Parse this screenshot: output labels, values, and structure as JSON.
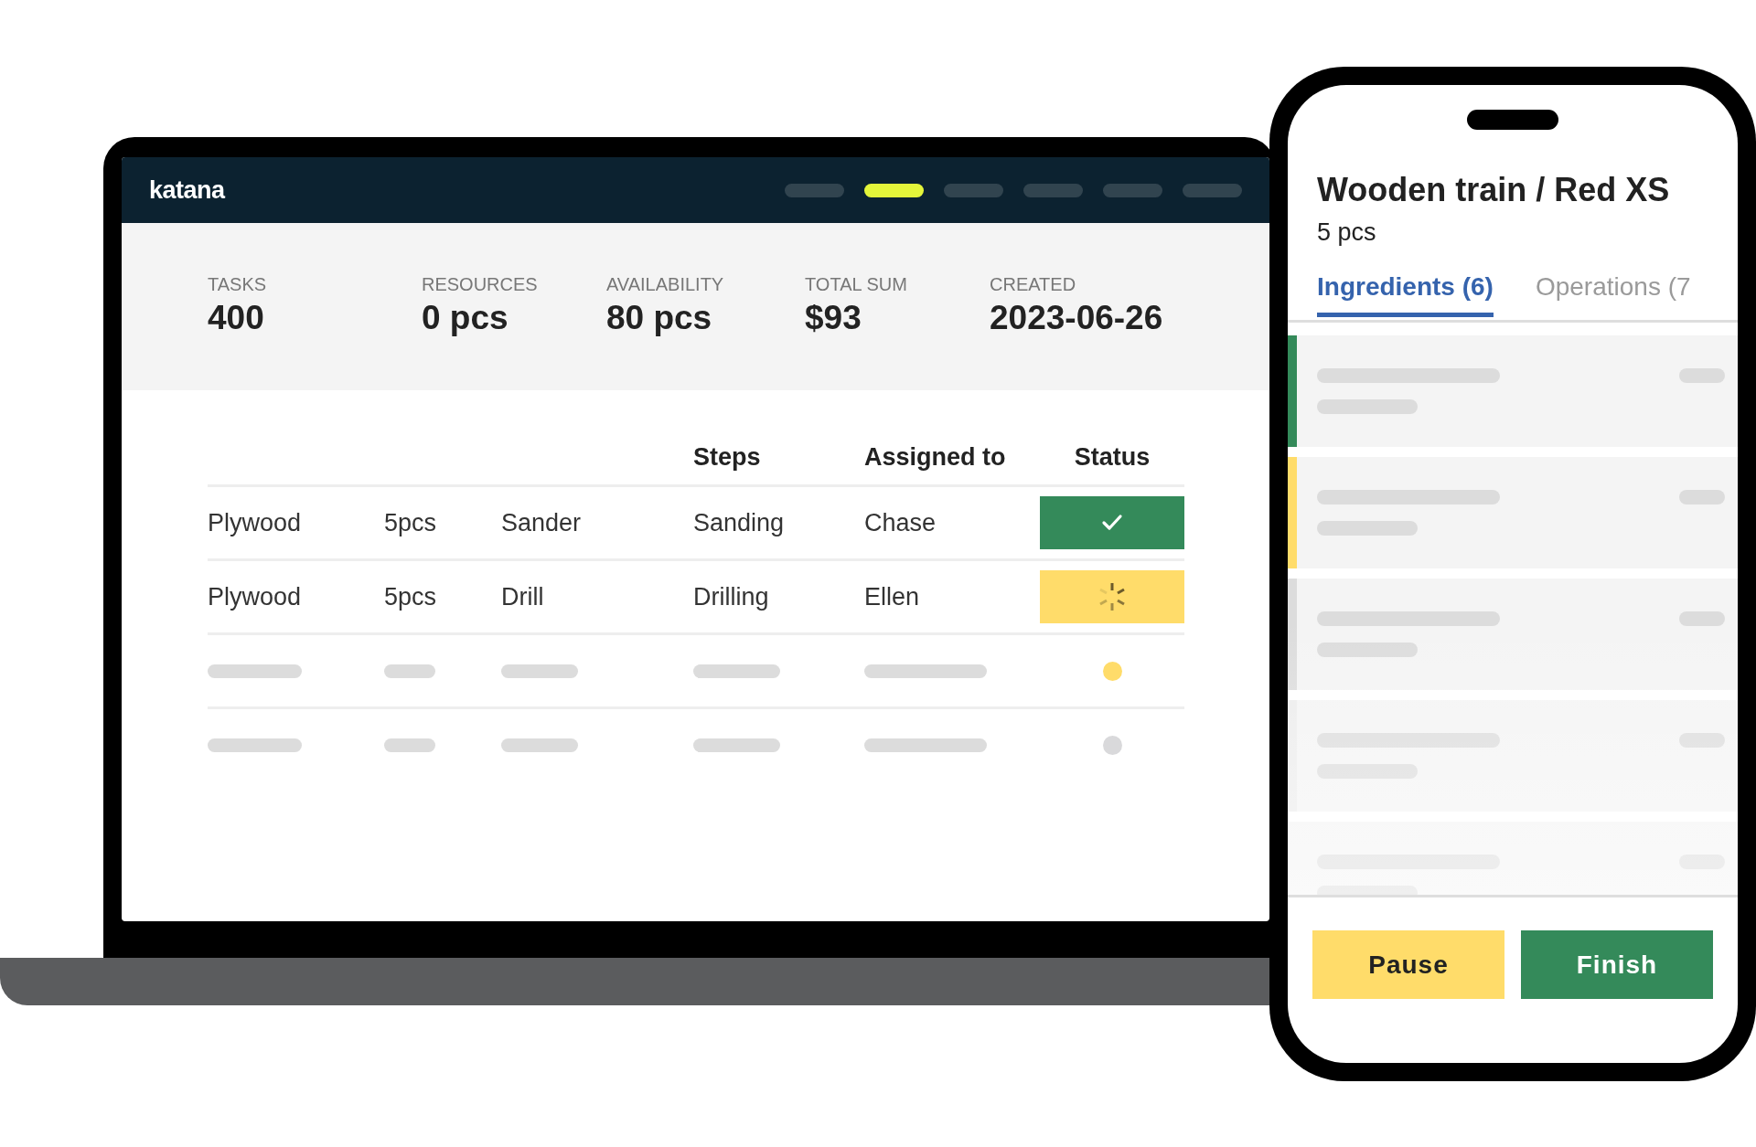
{
  "laptop": {
    "logo": "katana",
    "nav": [
      {
        "selected": false
      },
      {
        "selected": true
      },
      {
        "selected": false
      },
      {
        "selected": false
      },
      {
        "selected": false
      },
      {
        "selected": false
      }
    ],
    "stats": [
      {
        "label": "TASKS",
        "value": "400"
      },
      {
        "label": "RESOURCES",
        "value": "0 pcs"
      },
      {
        "label": "AVAILABILITY",
        "value": "80 pcs"
      },
      {
        "label": "TOTAL SUM",
        "value": "$93"
      },
      {
        "label": "CREATED",
        "value": "2023-06-26"
      }
    ],
    "table": {
      "headers": {
        "steps": "Steps",
        "assigned_to": "Assigned to",
        "status": "Status"
      },
      "rows": [
        {
          "kind": "done",
          "column_1": "Plywood",
          "column_2": "5pcs",
          "column_3": "Sander",
          "steps": "Sanding",
          "assigned_to": "Chase"
        },
        {
          "kind": "in_progress",
          "column_1": "Plywood",
          "column_2": "5pcs",
          "column_3": "Drill",
          "steps": "Drilling",
          "assigned_to": "Ellen"
        },
        {
          "kind": "placeholder",
          "color": "#ffdc6a"
        },
        {
          "kind": "placeholder",
          "color": "#d9d9db"
        }
      ]
    }
  },
  "phone": {
    "title": "Wooden train / Red XS",
    "quantity": "5 pcs",
    "tabs": [
      {
        "label": "Ingredients (6)",
        "selected": true
      },
      {
        "label": "Operations (7",
        "selected": false
      }
    ],
    "cards": [
      {
        "kind": "striped",
        "color": "#348a5a"
      },
      {
        "kind": "striped",
        "color": "#ffdc6a"
      },
      {
        "kind": "striped",
        "color": "#dcdcdc"
      },
      {
        "kind": "striped",
        "color": "#ececec"
      },
      {
        "kind": "plain"
      }
    ],
    "buttons": [
      {
        "label": "Pause",
        "kind": "secondary"
      },
      {
        "label": "Finish",
        "kind": "primary"
      }
    ]
  }
}
